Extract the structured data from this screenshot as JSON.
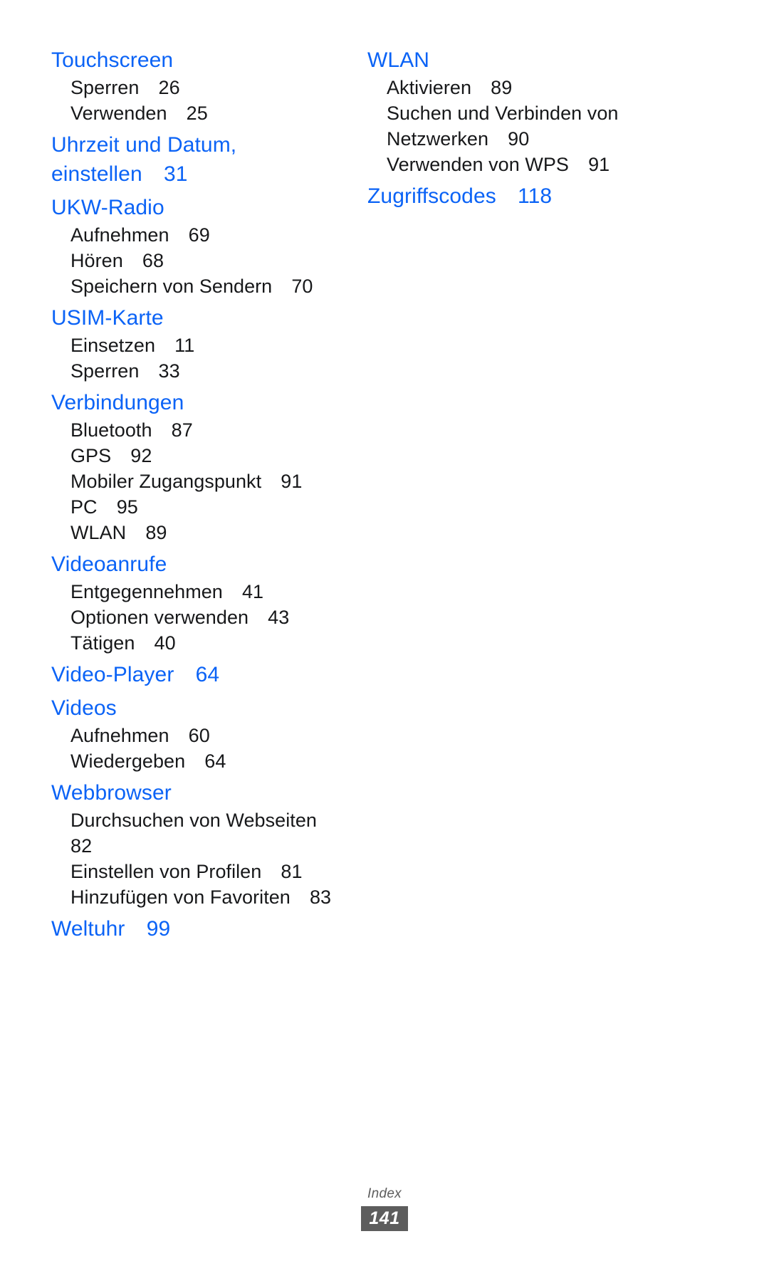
{
  "document": {
    "page_kind": "index",
    "language": "de",
    "accent_color": "#0b63f6",
    "text_color": "#17181a",
    "footer_box_color": "#5d5d5d"
  },
  "left_column": {
    "groups": [
      {
        "heading": "Touchscreen",
        "heading_page": "",
        "entries": [
          {
            "label": "Sperren",
            "page": "26"
          },
          {
            "label": "Verwenden",
            "page": "25"
          }
        ]
      },
      {
        "heading": "Uhrzeit und Datum, einstellen",
        "heading_page": "31",
        "entries": []
      },
      {
        "heading": "UKW-Radio",
        "heading_page": "",
        "entries": [
          {
            "label": "Aufnehmen",
            "page": "69"
          },
          {
            "label": "Hören",
            "page": "68"
          },
          {
            "label": "Speichern von Sendern",
            "page": "70"
          }
        ]
      },
      {
        "heading": "USIM-Karte",
        "heading_page": "",
        "entries": [
          {
            "label": "Einsetzen",
            "page": "11"
          },
          {
            "label": "Sperren",
            "page": "33"
          }
        ]
      },
      {
        "heading": "Verbindungen",
        "heading_page": "",
        "entries": [
          {
            "label": "Bluetooth",
            "page": "87"
          },
          {
            "label": "GPS",
            "page": "92"
          },
          {
            "label": "Mobiler Zugangspunkt",
            "page": "91"
          },
          {
            "label": "PC",
            "page": "95"
          },
          {
            "label": "WLAN",
            "page": "89"
          }
        ]
      },
      {
        "heading": "Videoanrufe",
        "heading_page": "",
        "entries": [
          {
            "label": "Entgegennehmen",
            "page": "41"
          },
          {
            "label": "Optionen verwenden",
            "page": "43"
          },
          {
            "label": "Tätigen",
            "page": "40"
          }
        ]
      },
      {
        "heading": "Video-Player",
        "heading_page": "64",
        "entries": []
      },
      {
        "heading": "Videos",
        "heading_page": "",
        "entries": [
          {
            "label": "Aufnehmen",
            "page": "60"
          },
          {
            "label": "Wiedergeben",
            "page": "64"
          }
        ]
      },
      {
        "heading": "Webbrowser",
        "heading_page": "",
        "entries": [
          {
            "label": "Durchsuchen von Webseiten",
            "page": "82"
          },
          {
            "label": "Einstellen von Profilen",
            "page": "81"
          },
          {
            "label": "Hinzufügen von Favoriten",
            "page": "83"
          }
        ]
      },
      {
        "heading": "Weltuhr",
        "heading_page": "99",
        "entries": []
      }
    ]
  },
  "right_column": {
    "groups": [
      {
        "heading": "WLAN",
        "heading_page": "",
        "entries": [
          {
            "label": "Aktivieren",
            "page": "89"
          },
          {
            "label": "Suchen und Verbinden von Netzwerken",
            "page": "90"
          },
          {
            "label": "Verwenden von WPS",
            "page": "91"
          }
        ]
      },
      {
        "heading": "Zugriffscodes",
        "heading_page": "118",
        "entries": []
      }
    ]
  },
  "footer": {
    "label": "Index",
    "page_number": "141"
  }
}
